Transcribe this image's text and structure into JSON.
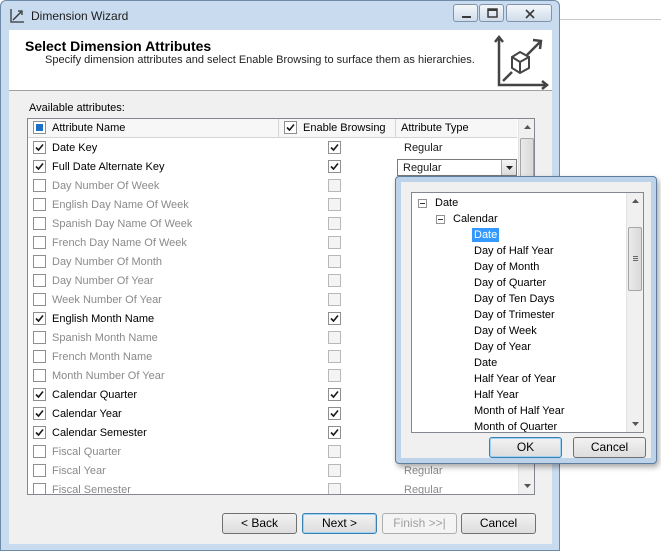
{
  "window": {
    "title": "Dimension Wizard"
  },
  "header": {
    "title": "Select Dimension Attributes",
    "subtitle": "Specify dimension attributes and select Enable Browsing to surface them as hierarchies."
  },
  "grid": {
    "label": "Available attributes:",
    "columns": [
      "Attribute Name",
      "Enable Browsing",
      "Attribute Type"
    ],
    "rows": [
      {
        "name": "Date Key",
        "selected": true,
        "browsing": true,
        "type": "Regular",
        "combo": false
      },
      {
        "name": "Full Date Alternate Key",
        "selected": true,
        "browsing": true,
        "type": "Regular",
        "combo": true
      },
      {
        "name": "Day Number Of Week",
        "selected": false,
        "browsing": false,
        "type": "",
        "combo": false
      },
      {
        "name": "English Day Name Of Week",
        "selected": false,
        "browsing": false,
        "type": "",
        "combo": false
      },
      {
        "name": "Spanish Day Name Of Week",
        "selected": false,
        "browsing": false,
        "type": "",
        "combo": false
      },
      {
        "name": "French Day Name Of Week",
        "selected": false,
        "browsing": false,
        "type": "",
        "combo": false
      },
      {
        "name": "Day Number Of Month",
        "selected": false,
        "browsing": false,
        "type": "",
        "combo": false
      },
      {
        "name": "Day Number Of Year",
        "selected": false,
        "browsing": false,
        "type": "",
        "combo": false
      },
      {
        "name": "Week Number Of Year",
        "selected": false,
        "browsing": false,
        "type": "",
        "combo": false
      },
      {
        "name": "English Month Name",
        "selected": true,
        "browsing": true,
        "type": "",
        "combo": false
      },
      {
        "name": "Spanish Month Name",
        "selected": false,
        "browsing": false,
        "type": "",
        "combo": false
      },
      {
        "name": "French Month Name",
        "selected": false,
        "browsing": false,
        "type": "",
        "combo": false
      },
      {
        "name": "Month Number Of Year",
        "selected": false,
        "browsing": false,
        "type": "",
        "combo": false
      },
      {
        "name": "Calendar Quarter",
        "selected": true,
        "browsing": true,
        "type": "",
        "combo": false
      },
      {
        "name": "Calendar Year",
        "selected": true,
        "browsing": true,
        "type": "",
        "combo": false
      },
      {
        "name": "Calendar Semester",
        "selected": true,
        "browsing": true,
        "type": "",
        "combo": false
      },
      {
        "name": "Fiscal Quarter",
        "selected": false,
        "browsing": false,
        "type": "",
        "combo": false
      },
      {
        "name": "Fiscal Year",
        "selected": false,
        "browsing": false,
        "type": "Regular",
        "combo": false
      },
      {
        "name": "Fiscal Semester",
        "selected": false,
        "browsing": false,
        "type": "Regular",
        "combo": false
      }
    ]
  },
  "buttons": {
    "back": "< Back",
    "next": "Next >",
    "finish": "Finish >>|",
    "cancel": "Cancel"
  },
  "popup": {
    "tree": [
      {
        "label": "Date",
        "level": 0,
        "expander": true
      },
      {
        "label": "Calendar",
        "level": 1,
        "expander": true
      },
      {
        "label": "Date",
        "level": 2,
        "selected": true
      },
      {
        "label": "Day of Half Year",
        "level": 2
      },
      {
        "label": "Day of Month",
        "level": 2
      },
      {
        "label": "Day of Quarter",
        "level": 2
      },
      {
        "label": "Day of Ten Days",
        "level": 2
      },
      {
        "label": "Day of Trimester",
        "level": 2
      },
      {
        "label": "Day of Week",
        "level": 2
      },
      {
        "label": "Day of Year",
        "level": 2
      },
      {
        "label": "Date",
        "level": 2
      },
      {
        "label": "Half Year of Year",
        "level": 2
      },
      {
        "label": "Half Year",
        "level": 2
      },
      {
        "label": "Month of Half Year",
        "level": 2
      },
      {
        "label": "Month of Quarter",
        "level": 2
      }
    ],
    "ok": "OK",
    "cancel": "Cancel"
  },
  "colors": {
    "frame": "#c9dcef",
    "selection": "#3399ff",
    "check": "#1b1b1b"
  }
}
